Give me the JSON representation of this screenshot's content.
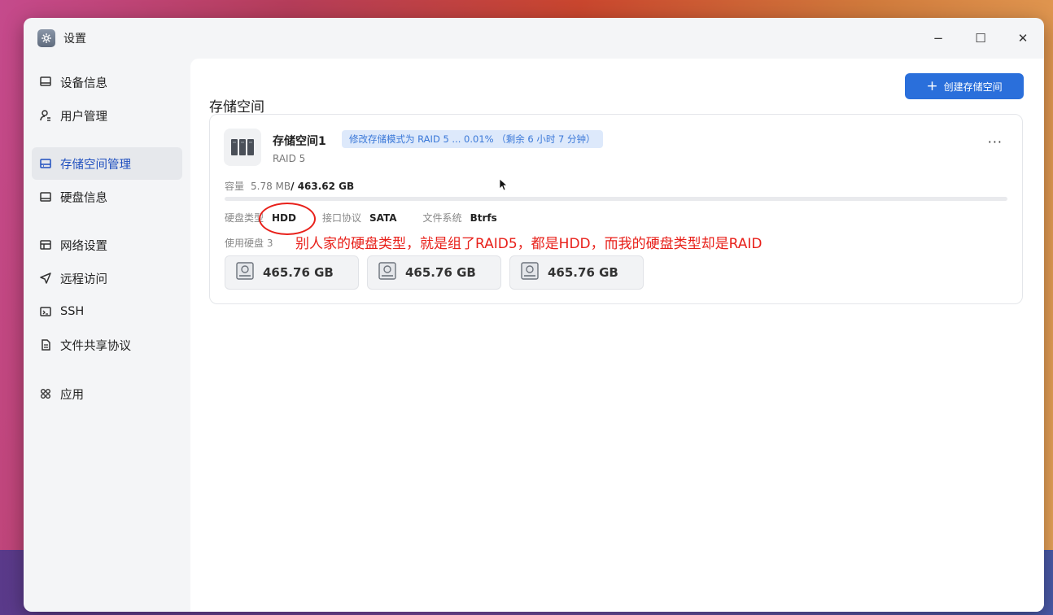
{
  "window": {
    "title": "设置"
  },
  "controls": {
    "minimize": "−",
    "maximize": "☐",
    "close": "✕"
  },
  "sidebar": {
    "items": [
      {
        "label": "设备信息",
        "icon": "monitor-icon",
        "active": false
      },
      {
        "label": "用户管理",
        "icon": "user-icon",
        "active": false
      },
      {
        "label": "存储空间管理",
        "icon": "storage-icon",
        "active": true
      },
      {
        "label": "硬盘信息",
        "icon": "disk-icon",
        "active": false
      },
      {
        "label": "网络设置",
        "icon": "network-icon",
        "active": false
      },
      {
        "label": "远程访问",
        "icon": "send-icon",
        "active": false
      },
      {
        "label": "SSH",
        "icon": "terminal-icon",
        "active": false
      },
      {
        "label": "文件共享协议",
        "icon": "document-icon",
        "active": false
      },
      {
        "label": "应用",
        "icon": "apps-icon",
        "active": false
      }
    ]
  },
  "main": {
    "title": "存储空间",
    "create_button": "创建存储空间",
    "create_icon": "+"
  },
  "volume": {
    "name": "存储空间1",
    "status": "修改存储模式为 RAID 5 ... 0.01% （剩余 6 小时 7 分钟）",
    "raid": "RAID 5",
    "more": "···",
    "capacity_label": "容量",
    "used": "5.78 MB",
    "total": "/ 463.62 GB",
    "usage_fraction": 1.25e-05,
    "disk_type_label": "硬盘类型",
    "disk_type": "HDD",
    "interface_label": "接口协议",
    "interface": "SATA",
    "fs_label": "文件系统",
    "fs": "Btrfs",
    "disks_label": "使用硬盘 3",
    "disks": [
      "465.76 GB",
      "465.76 GB",
      "465.76 GB"
    ]
  },
  "annotation": "别人家的硬盘类型，就是组了RAID5，都是HDD，而我的硬盘类型却是RAID",
  "colors": {
    "accent": "#2a6fdb",
    "annotation": "#e8201a"
  }
}
